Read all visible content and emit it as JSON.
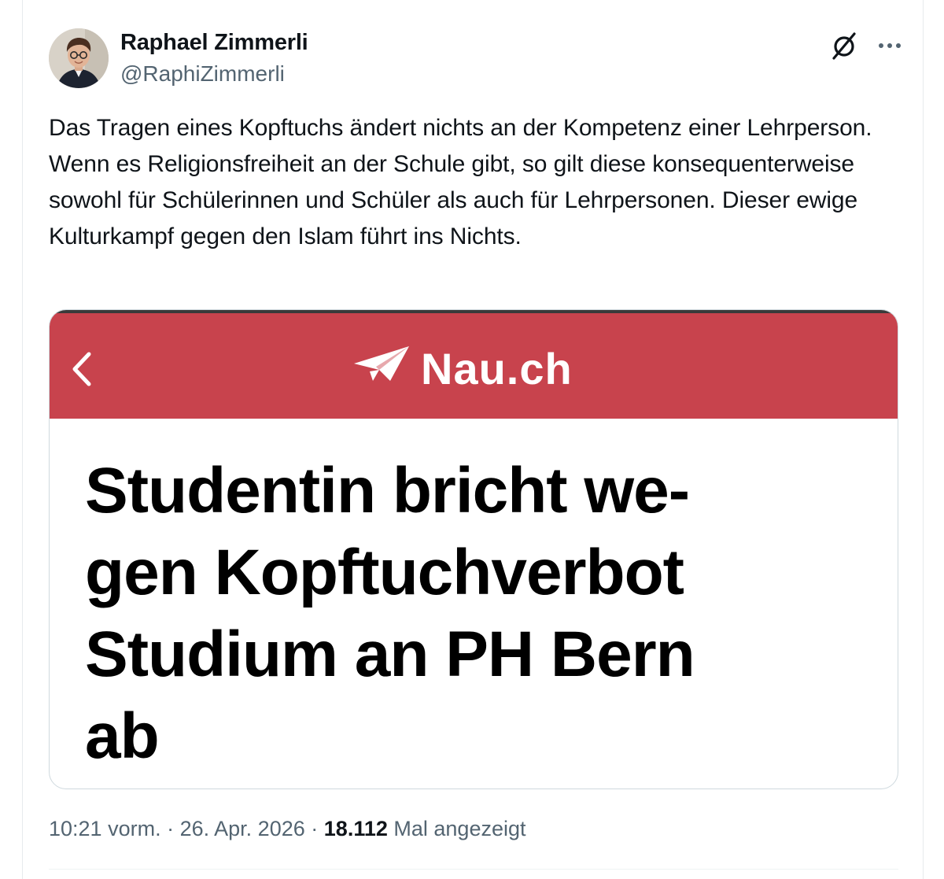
{
  "author": {
    "name": "Raphael Zimmerli",
    "handle": "@RaphiZimmerli"
  },
  "icons": {
    "grok": "grok-icon",
    "more": "more-dots-icon",
    "back": "chevron-left-icon",
    "logo": "paper-plane-icon"
  },
  "tweet": {
    "text": "Das Tragen eines Kopftuchs ändert nichts an der Kompetenz einer Lehrperson. Wenn es Religionsfreiheit an der Schule gibt, so gilt diese konsequenterweise sowohl für Schülerinnen und Schüler als auch für Lehrpersonen. Dieser ewige Kulturkampf gegen den Islam führt ins Nichts."
  },
  "media": {
    "site_name": "Nau.ch",
    "header_color": "#c8434d",
    "headline_lines": [
      "Studentin bricht we-",
      "gen Kopftuchverbot",
      "Studium an PH Bern",
      "ab"
    ]
  },
  "meta": {
    "time": "10:21 vorm.",
    "separator": "·",
    "date": "26. Apr. 2026",
    "views_count": "18.112",
    "views_label": "Mal angezeigt"
  },
  "colors": {
    "text_primary": "#0f1419",
    "text_secondary": "#536471",
    "border": "#cfd9de"
  }
}
